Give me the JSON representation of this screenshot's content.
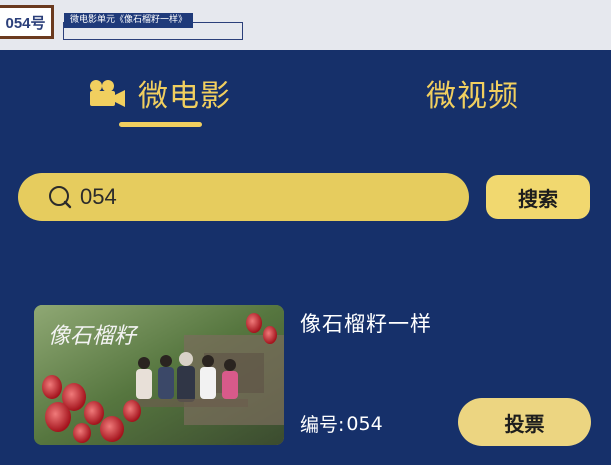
{
  "header": {
    "entry_number": "054号",
    "category_tag": "微电影单元《像石榴籽一样》"
  },
  "tabs": [
    {
      "label": "微电影",
      "icon": "movie-camera-icon",
      "active": true
    },
    {
      "label": "微视频",
      "active": false
    }
  ],
  "search": {
    "value": "054",
    "button_label": "搜索"
  },
  "card": {
    "title": "像石榴籽一样",
    "code_label": "编号:",
    "code_value": "054",
    "vote_label": "投票",
    "thumbnail_calligraphy": "像石榴籽"
  },
  "colors": {
    "background": "#16306a",
    "accent_gold": "#f1cf5f",
    "search_bg": "#e6cc5e"
  }
}
